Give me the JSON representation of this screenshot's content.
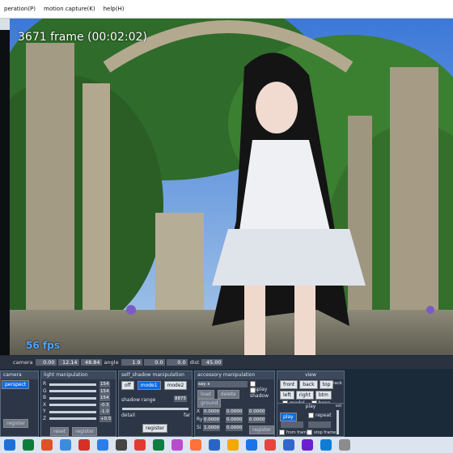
{
  "menu": {
    "items": [
      "peration(P)",
      "motion capture(K)",
      "help(H)"
    ]
  },
  "viewport": {
    "frame_label": "3671 frame (00:02:02)",
    "fps_label": "56 fps"
  },
  "status": {
    "camera_label": "camera",
    "camera_values": [
      "0.00",
      "12.14",
      "48.84"
    ],
    "angle_label": "angle",
    "angle_values": [
      "1.9",
      "0.0",
      "0.0"
    ],
    "dist_label": "dist",
    "dist_value": "45.00"
  },
  "camera_panel": {
    "title": "camera",
    "perspect_label": "perspect",
    "buttons": [
      "register"
    ]
  },
  "light_panel": {
    "title": "light manipulation",
    "channels": [
      {
        "label": "R",
        "value": "154"
      },
      {
        "label": "G",
        "value": "154"
      },
      {
        "label": "B",
        "value": "154"
      },
      {
        "label": "X",
        "value": "-0.5"
      },
      {
        "label": "Y",
        "value": "-1.0"
      },
      {
        "label": "Z",
        "value": "+0.5"
      }
    ],
    "reset_label": "reset",
    "register_label": "register"
  },
  "shadow_panel": {
    "title": "self_shadow manipulation",
    "modes": [
      "off",
      "mode1",
      "mode2"
    ],
    "range_label": "shadow range",
    "range_value": "8875",
    "detail_label": "detail",
    "far_label": "far",
    "register_label": "register"
  },
  "accessory_panel": {
    "title": "accessory manipulation",
    "dropdown": "say x",
    "display_label": "display",
    "shadow_label": "shadow",
    "buttons": [
      "load",
      "delete",
      "ground"
    ],
    "coords": [
      {
        "label": "X",
        "values": [
          "0.0000",
          "0.0000",
          "0.0000"
        ]
      },
      {
        "label": "Ry",
        "values": [
          "0.0000",
          "0.0000",
          "0.0000"
        ]
      },
      {
        "label": "Si",
        "values": [
          "1.0000",
          "0.0000",
          ""
        ]
      }
    ],
    "register_label": "register"
  },
  "view_panel": {
    "title": "view",
    "row1": [
      "front",
      "back",
      "top"
    ],
    "row2": [
      "left",
      "right",
      "btm"
    ],
    "track_label": "track",
    "model_label": "model",
    "bone_label": "bone",
    "play_title": "play",
    "play_label": "play",
    "repeat_label": "repeat",
    "from_frame_label": "from frame",
    "stop_frame_label": "stop frame",
    "vol_label": "vol"
  },
  "taskbar": {
    "colors": [
      "#1f6fd6",
      "#0a7d3b",
      "#e34f26",
      "#3c8cdc",
      "#d93025",
      "#2b7de9",
      "#444444",
      "#e23b2e",
      "#107c41",
      "#b84ccf",
      "#ff7139",
      "#2b63c9",
      "#f2a900",
      "#1a73e8",
      "#e8433e",
      "#3366cc",
      "#6a1fd1",
      "#0f7cd6",
      "#8c8c8c"
    ]
  }
}
